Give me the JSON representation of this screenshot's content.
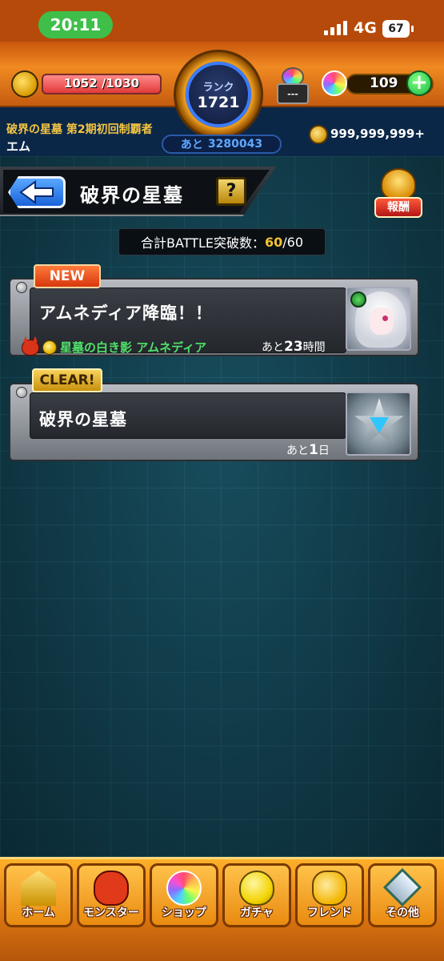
{
  "status_bar": {
    "time": "20:11",
    "network": "4G",
    "battery": "67"
  },
  "header": {
    "stamina": {
      "current": "1052",
      "max": "/1030",
      "fill_fraction": 1.0
    },
    "rank": {
      "label": "ランク",
      "value": "1721",
      "exp_prefix": "あと",
      "exp_remaining": "3280043"
    },
    "luck_label": "---",
    "orbs": "109",
    "player_title": "破界の星墓 第2期初回制覇者",
    "player_name": "エム",
    "coins": "999,999,999+"
  },
  "page": {
    "title": "破界の星墓",
    "help_label": "?",
    "reward_label": "報酬"
  },
  "summary": {
    "label": "合計BATTLE突破数：",
    "current": "60",
    "total": "/60"
  },
  "quests": [
    {
      "badge": "NEW",
      "name": "アムネディア降臨！！",
      "boss_text": "星墓の白き影 アムネディア",
      "remaining_prefix": "あと",
      "remaining_value": "23",
      "remaining_unit": "時間",
      "thumb_icon": "amnedia-portrait-icon"
    },
    {
      "badge": "CLEAR!",
      "name": "破界の星墓",
      "remaining_prefix": "あと",
      "remaining_value": "1",
      "remaining_unit": "日",
      "thumb_icon": "silver-star-icon"
    }
  ],
  "nav": [
    {
      "label": "ホーム",
      "icon": "home-icon"
    },
    {
      "label": "モンスター",
      "icon": "monster-icon"
    },
    {
      "label": "ショップ",
      "icon": "orb-icon"
    },
    {
      "label": "ガチャ",
      "icon": "gacha-egg-icon"
    },
    {
      "label": "フレンド",
      "icon": "friends-icon"
    },
    {
      "label": "その他",
      "icon": "other-icon"
    }
  ],
  "colors": {
    "header_orange": "#e77c1b",
    "accent_green": "#4fe36a",
    "summary_highlight": "#f2c230",
    "back_blue": "#1a63d8"
  }
}
